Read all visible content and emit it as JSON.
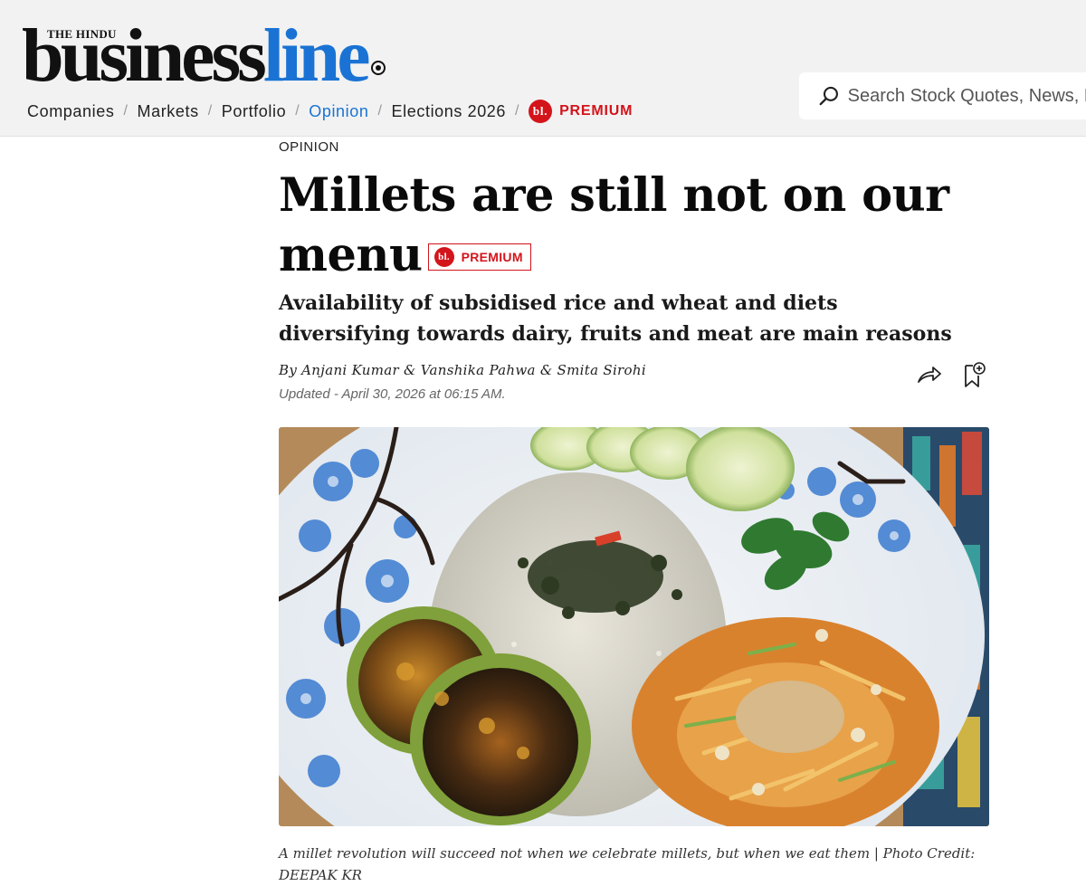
{
  "brand": {
    "parent": "THE HINDU",
    "name_part1": "business",
    "name_part2": "line"
  },
  "nav": {
    "items": [
      {
        "label": "Companies",
        "active": false
      },
      {
        "label": "Markets",
        "active": false
      },
      {
        "label": "Portfolio",
        "active": false
      },
      {
        "label": "Opinion",
        "active": true
      },
      {
        "label": "Elections 2026",
        "active": false
      }
    ],
    "separator": "/",
    "premium_badge": "bl.",
    "premium_label": "PREMIUM"
  },
  "search": {
    "placeholder": "Search Stock Quotes, News, NAVs"
  },
  "article": {
    "section": "OPINION",
    "headline": "Millets are still not on our menu",
    "premium_badge": "bl.",
    "premium_label": "PREMIUM",
    "subheadline": "Availability of subsidised rice and wheat and diets diversifying towards dairy, fruits and meat are main reasons",
    "byline": "By Anjani Kumar & Vanshika Pahwa & Smita Sirohi",
    "updated": "Updated - April 30, 2026 at 06:15 AM.",
    "caption": "A millet revolution will succeed not when we celebrate millets, but when we eat them | Photo Credit: DEEPAK KR"
  },
  "colors": {
    "accent": "#1a73d4",
    "premium": "#d3141b",
    "header_bg": "#f2f2f2"
  },
  "icons": [
    "search-icon",
    "share-icon",
    "bookmark-add-icon",
    "logo-dot-icon"
  ]
}
